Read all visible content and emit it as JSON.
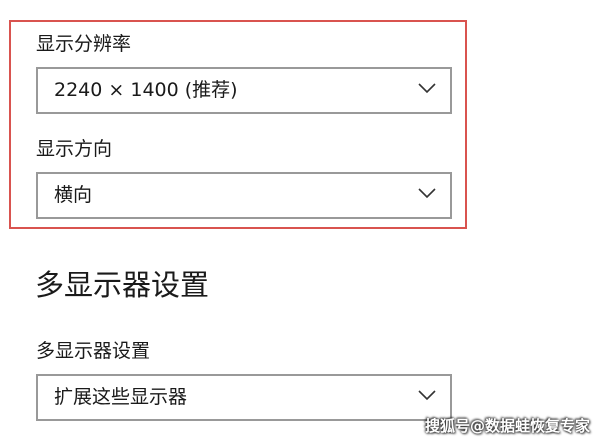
{
  "display": {
    "resolution_label": "显示分辨率",
    "resolution_value": "2240 × 1400 (推荐)",
    "orientation_label": "显示方向",
    "orientation_value": "横向",
    "highlight_color": "#d9534f"
  },
  "multi_display": {
    "heading": "多显示器设置",
    "setting_label": "多显示器设置",
    "setting_value": "扩展这些显示器"
  },
  "icons": {
    "dropdown_icon": "chevron-down-icon"
  },
  "watermark": {
    "text": "搜狐号@数据蛙恢复专家"
  }
}
